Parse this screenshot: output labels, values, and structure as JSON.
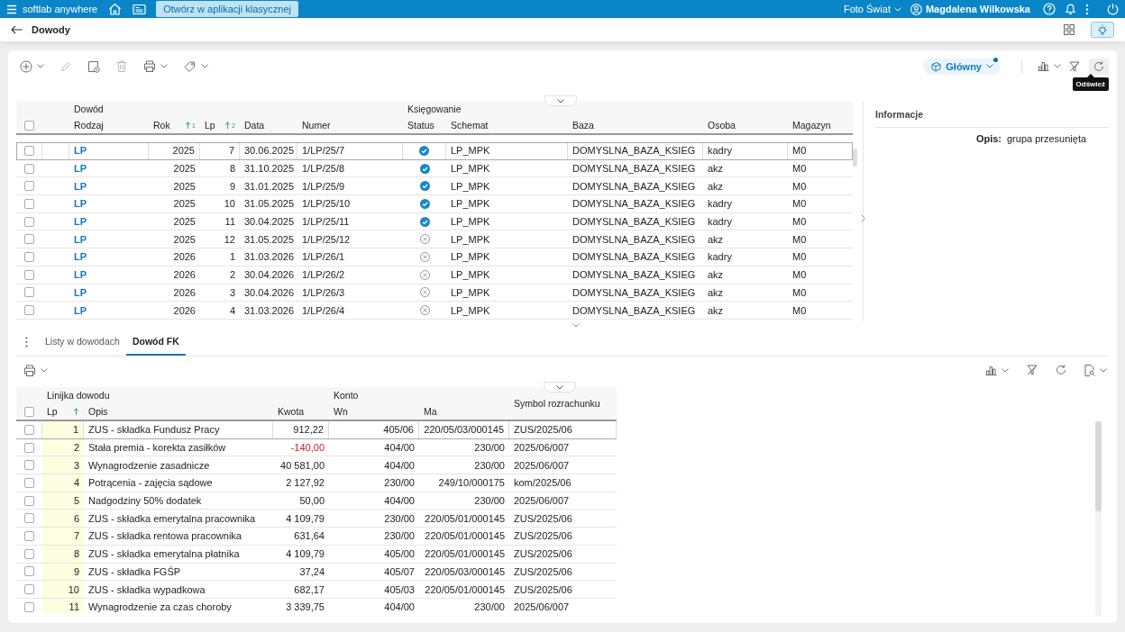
{
  "top_bar": {
    "app_name": "softlab anywhere",
    "open_classic_button": "Otwórz w aplikacji klasycznej",
    "company": "Foto Świat",
    "user": "Magdalena Wilkowska"
  },
  "page": {
    "title": "Dowody"
  },
  "toolbar": {
    "view_button": "Główny",
    "view_modified": true,
    "tooltip": "Odśwież"
  },
  "documents": {
    "select_all_checked": false,
    "groups": [
      {
        "label": "Dowód",
        "columns": [
          {
            "label": "Rodzaj",
            "kind": "link"
          },
          {
            "label": "Rok",
            "kind": "text",
            "sorted_ascending": true,
            "sort_order": "1"
          },
          {
            "label": "Lp",
            "kind": "text",
            "sorted_ascending": true,
            "sort_order": "2"
          },
          {
            "label": "Data",
            "kind": "text"
          },
          {
            "label": "Numer",
            "kind": "text"
          }
        ]
      },
      {
        "label": "Księgowanie",
        "columns": [
          {
            "label": "Status",
            "kind": "status"
          },
          {
            "label": "Schemat",
            "kind": "text"
          },
          {
            "label": "Baza",
            "kind": "text"
          },
          {
            "label": "Osoba",
            "kind": "text"
          },
          {
            "label": "Magazyn",
            "kind": "text"
          }
        ]
      }
    ],
    "rows": [
      {
        "checked": false,
        "selected": true,
        "posted": true,
        "cells": [
          "LP",
          "2025",
          "7",
          "30.06.2025",
          "1/LP/25/7",
          "LP_MPK",
          "DOMYSLNA_BAZA_KSIEG",
          "kadry",
          "M0"
        ]
      },
      {
        "checked": false,
        "selected": false,
        "posted": true,
        "cells": [
          "LP",
          "2025",
          "8",
          "31.10.2025",
          "1/LP/25/8",
          "LP_MPK",
          "DOMYSLNA_BAZA_KSIEG",
          "akz",
          "M0"
        ]
      },
      {
        "checked": false,
        "selected": false,
        "posted": true,
        "cells": [
          "LP",
          "2025",
          "9",
          "31.01.2025",
          "1/LP/25/9",
          "LP_MPK",
          "DOMYSLNA_BAZA_KSIEG",
          "akz",
          "M0"
        ]
      },
      {
        "checked": false,
        "selected": false,
        "posted": true,
        "cells": [
          "LP",
          "2025",
          "10",
          "31.05.2025",
          "1/LP/25/10",
          "LP_MPK",
          "DOMYSLNA_BAZA_KSIEG",
          "kadry",
          "M0"
        ]
      },
      {
        "checked": false,
        "selected": false,
        "posted": true,
        "cells": [
          "LP",
          "2025",
          "11",
          "30.04.2025",
          "1/LP/25/11",
          "LP_MPK",
          "DOMYSLNA_BAZA_KSIEG",
          "kadry",
          "M0"
        ]
      },
      {
        "checked": false,
        "selected": false,
        "posted": false,
        "cells": [
          "LP",
          "2025",
          "12",
          "31.05.2025",
          "1/LP/25/12",
          "LP_MPK",
          "DOMYSLNA_BAZA_KSIEG",
          "akz",
          "M0"
        ]
      },
      {
        "checked": false,
        "selected": false,
        "posted": false,
        "cells": [
          "LP",
          "2026",
          "1",
          "31.03.2026",
          "1/LP/26/1",
          "LP_MPK",
          "DOMYSLNA_BAZA_KSIEG",
          "kadry",
          "M0"
        ]
      },
      {
        "checked": false,
        "selected": false,
        "posted": false,
        "cells": [
          "LP",
          "2026",
          "2",
          "30.04.2026",
          "1/LP/26/2",
          "LP_MPK",
          "DOMYSLNA_BAZA_KSIEG",
          "akz",
          "M0"
        ]
      },
      {
        "checked": false,
        "selected": false,
        "posted": false,
        "cells": [
          "LP",
          "2026",
          "3",
          "30.04.2026",
          "1/LP/26/3",
          "LP_MPK",
          "DOMYSLNA_BAZA_KSIEG",
          "akz",
          "M0"
        ]
      },
      {
        "checked": false,
        "selected": false,
        "posted": false,
        "cells": [
          "LP",
          "2026",
          "4",
          "31.03.2026",
          "1/LP/26/4",
          "LP_MPK",
          "DOMYSLNA_BAZA_KSIEG",
          "akz",
          "M0"
        ]
      }
    ]
  },
  "info_panel": {
    "title": "Informacje",
    "fields": [
      {
        "label": "Opis:",
        "value": "grupa przesunięta"
      }
    ]
  },
  "tabs": [
    {
      "label": "Listy w dowodach",
      "selected": false
    },
    {
      "label": "Dowód FK",
      "selected": true
    }
  ],
  "lines": {
    "select_all_checked": false,
    "groups": [
      {
        "label": "Linijka dowodu",
        "columns": [
          {
            "label": "Lp",
            "sorted_ascending": true
          },
          {
            "label": "Opis",
            "sorted_ascending": false
          },
          {
            "label": "Kwota",
            "sorted_ascending": false
          }
        ]
      },
      {
        "label": "Konto",
        "columns": [
          {
            "label": "Wn",
            "sorted_ascending": false
          },
          {
            "label": "Ma",
            "sorted_ascending": false
          }
        ]
      },
      {
        "label": "Symbol rozrachunku"
      }
    ],
    "rows": [
      {
        "checked": false,
        "selected": true,
        "negative": false,
        "cells": [
          "1",
          "ZUS - składka Fundusz Pracy",
          "912,22",
          "405/06",
          "220/05/03/000145",
          "ZUS/2025/06"
        ]
      },
      {
        "checked": false,
        "selected": false,
        "negative": true,
        "cells": [
          "2",
          "Stała premia - korekta zasiłków",
          "-140,00",
          "404/00",
          "230/00",
          "2025/06/007"
        ]
      },
      {
        "checked": false,
        "selected": false,
        "negative": false,
        "cells": [
          "3",
          "Wynagrodzenie zasadnicze",
          "40 581,00",
          "404/00",
          "230/00",
          "2025/06/007"
        ]
      },
      {
        "checked": false,
        "selected": false,
        "negative": false,
        "cells": [
          "4",
          "Potrącenia - zajęcia sądowe",
          "2 127,92",
          "230/00",
          "249/10/000175",
          "kom/2025/06"
        ]
      },
      {
        "checked": false,
        "selected": false,
        "negative": false,
        "cells": [
          "5",
          "Nadgodziny 50% dodatek",
          "50,00",
          "404/00",
          "230/00",
          "2025/06/007"
        ]
      },
      {
        "checked": false,
        "selected": false,
        "negative": false,
        "cells": [
          "6",
          "ZUS - składka emerytalna pracownika",
          "4 109,79",
          "230/00",
          "220/05/01/000145",
          "ZUS/2025/06"
        ]
      },
      {
        "checked": false,
        "selected": false,
        "negative": false,
        "cells": [
          "7",
          "ZUS - składka rentowa pracownika",
          "631,64",
          "230/00",
          "220/05/01/000145",
          "ZUS/2025/06"
        ]
      },
      {
        "checked": false,
        "selected": false,
        "negative": false,
        "cells": [
          "8",
          "ZUS - składka emerytalna płatnika",
          "4 109,79",
          "405/00",
          "220/05/01/000145",
          "ZUS/2025/06"
        ]
      },
      {
        "checked": false,
        "selected": false,
        "negative": false,
        "cells": [
          "9",
          "ZUS - składka FGŚP",
          "37,24",
          "405/07",
          "220/05/03/000145",
          "ZUS/2025/06"
        ]
      },
      {
        "checked": false,
        "selected": false,
        "negative": false,
        "cells": [
          "10",
          "ZUS - składka wypadkowa",
          "682,17",
          "405/03",
          "220/05/01/000145",
          "ZUS/2025/06"
        ]
      },
      {
        "checked": false,
        "selected": false,
        "negative": false,
        "cells": [
          "11",
          "Wynagrodzenie za czas choroby",
          "3 339,75",
          "404/00",
          "230/00",
          "2025/06/007"
        ]
      }
    ]
  }
}
